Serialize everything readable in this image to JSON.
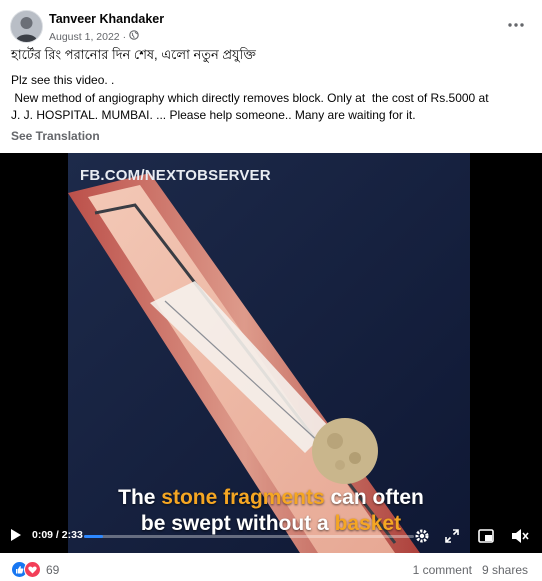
{
  "post": {
    "author": "Tanveer Khandaker",
    "date": "August 1, 2022",
    "privacy_separator": "·",
    "title": "হার্টের রিং পরানোর দিন শেষ, এলো নতুন প্রযুক্তি",
    "body_lines": [
      "Plz see this video. .",
      " New method of angiography which directly removes block. Only at  the cost of Rs.5000 at",
      "J. J. HOSPITAL. MUMBAI. ... Please help someone.. Many are waiting for it."
    ],
    "see_translation": "See Translation"
  },
  "video": {
    "watermark": "FB.COM/NEXTOBSERVER",
    "subtitle": {
      "part1": "The ",
      "highlight1": "stone fragments",
      "part2": " can often",
      "part3": "be swept without a ",
      "highlight2": "basket"
    },
    "time": "0:09 / 2:33",
    "progress_fraction": 0.059,
    "accent_color": "#2d88ff",
    "highlight_color": "#f5a623"
  },
  "footer": {
    "reaction_count": "69",
    "comments": "1 comment",
    "shares": "9 shares"
  },
  "icons": {
    "globe": "globe-icon",
    "more": "more-horizontal-icon",
    "play": "play-icon",
    "settings": "gear-icon",
    "expand": "expand-icon",
    "pip": "picture-in-picture-icon",
    "volume": "volume-icon",
    "like": "like-icon",
    "love": "love-icon"
  }
}
